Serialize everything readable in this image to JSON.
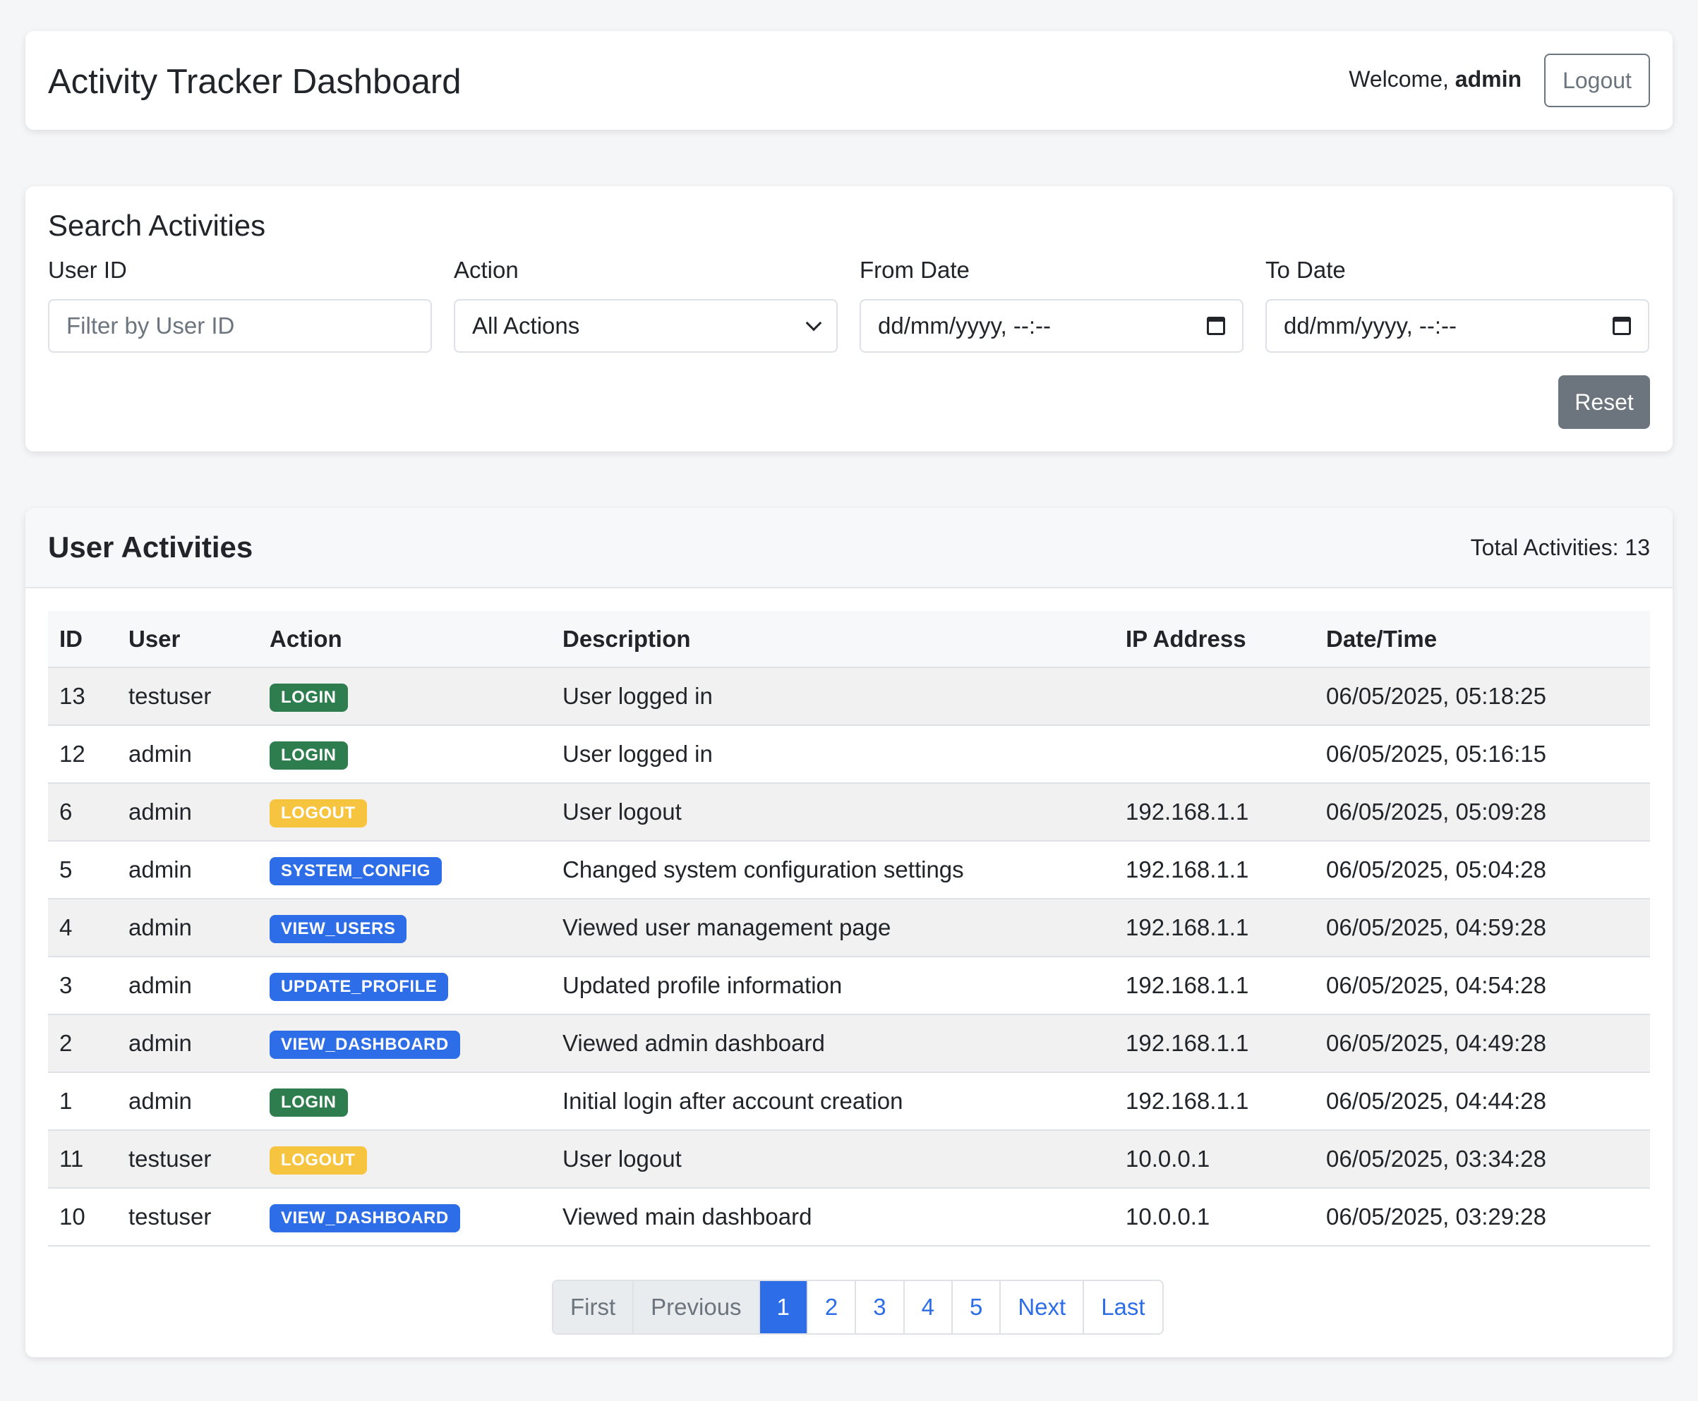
{
  "header": {
    "title": "Activity Tracker Dashboard",
    "welcome_prefix": "Welcome,",
    "username": "admin",
    "logout_label": "Logout"
  },
  "search": {
    "title": "Search Activities",
    "user_id_label": "User ID",
    "user_id_placeholder": "Filter by User ID",
    "action_label": "Action",
    "action_value": "All Actions",
    "from_date_label": "From Date",
    "from_date_value": "dd/mm/yyyy, --:--",
    "to_date_label": "To Date",
    "to_date_value": "dd/mm/yyyy, --:--",
    "reset_label": "Reset"
  },
  "activities": {
    "title": "User Activities",
    "total_label": "Total Activities: 13",
    "columns": [
      "ID",
      "User",
      "Action",
      "Description",
      "IP Address",
      "Date/Time"
    ],
    "rows": [
      {
        "id": "13",
        "user": "testuser",
        "action": "LOGIN",
        "color": "green",
        "description": "User logged in",
        "ip": "",
        "datetime": "06/05/2025, 05:18:25"
      },
      {
        "id": "12",
        "user": "admin",
        "action": "LOGIN",
        "color": "green",
        "description": "User logged in",
        "ip": "",
        "datetime": "06/05/2025, 05:16:15"
      },
      {
        "id": "6",
        "user": "admin",
        "action": "LOGOUT",
        "color": "yellow",
        "description": "User logout",
        "ip": "192.168.1.1",
        "datetime": "06/05/2025, 05:09:28"
      },
      {
        "id": "5",
        "user": "admin",
        "action": "SYSTEM_CONFIG",
        "color": "blue",
        "description": "Changed system configuration settings",
        "ip": "192.168.1.1",
        "datetime": "06/05/2025, 05:04:28"
      },
      {
        "id": "4",
        "user": "admin",
        "action": "VIEW_USERS",
        "color": "blue",
        "description": "Viewed user management page",
        "ip": "192.168.1.1",
        "datetime": "06/05/2025, 04:59:28"
      },
      {
        "id": "3",
        "user": "admin",
        "action": "UPDATE_PROFILE",
        "color": "blue",
        "description": "Updated profile information",
        "ip": "192.168.1.1",
        "datetime": "06/05/2025, 04:54:28"
      },
      {
        "id": "2",
        "user": "admin",
        "action": "VIEW_DASHBOARD",
        "color": "blue",
        "description": "Viewed admin dashboard",
        "ip": "192.168.1.1",
        "datetime": "06/05/2025, 04:49:28"
      },
      {
        "id": "1",
        "user": "admin",
        "action": "LOGIN",
        "color": "green",
        "description": "Initial login after account creation",
        "ip": "192.168.1.1",
        "datetime": "06/05/2025, 04:44:28"
      },
      {
        "id": "11",
        "user": "testuser",
        "action": "LOGOUT",
        "color": "yellow",
        "description": "User logout",
        "ip": "10.0.0.1",
        "datetime": "06/05/2025, 03:34:28"
      },
      {
        "id": "10",
        "user": "testuser",
        "action": "VIEW_DASHBOARD",
        "color": "blue",
        "description": "Viewed main dashboard",
        "ip": "10.0.0.1",
        "datetime": "06/05/2025, 03:29:28"
      }
    ]
  },
  "pagination": {
    "items": [
      {
        "label": "First",
        "state": "disabled"
      },
      {
        "label": "Previous",
        "state": "disabled"
      },
      {
        "label": "1",
        "state": "active"
      },
      {
        "label": "2",
        "state": ""
      },
      {
        "label": "3",
        "state": ""
      },
      {
        "label": "4",
        "state": ""
      },
      {
        "label": "5",
        "state": ""
      },
      {
        "label": "Next",
        "state": ""
      },
      {
        "label": "Last",
        "state": ""
      }
    ]
  },
  "colors": {
    "green": "#2e7d4f",
    "yellow": "#f7c440",
    "blue": "#2d6ee8",
    "secondary": "#6c757d"
  }
}
